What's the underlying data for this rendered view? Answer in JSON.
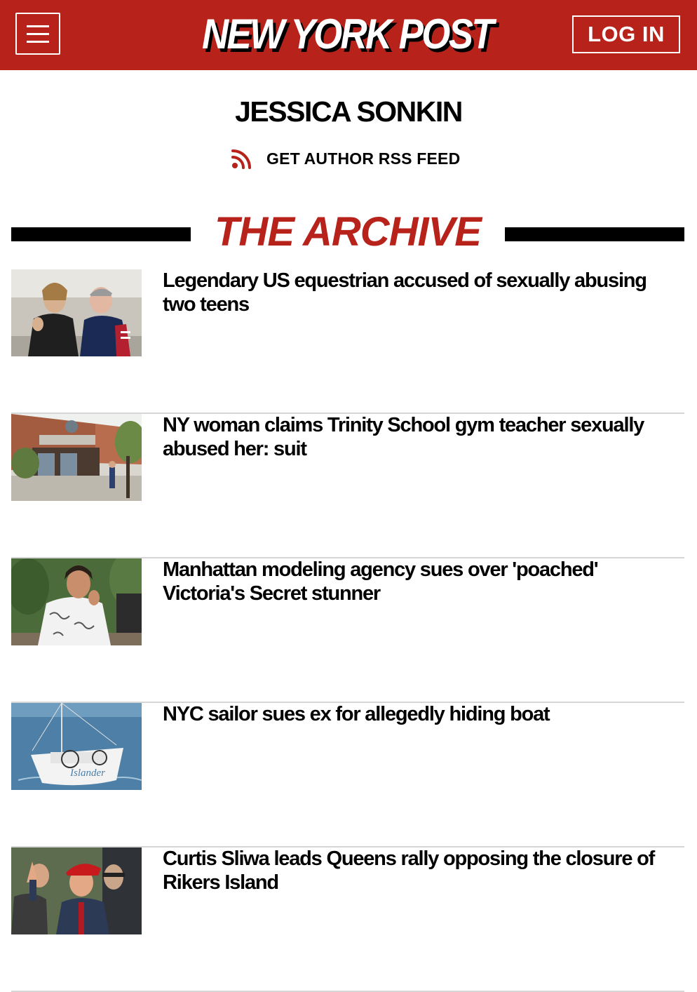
{
  "header": {
    "logo_text": "NEW YORK POST",
    "login_label": "LOG IN",
    "menu_icon": "hamburger-menu-icon",
    "brand_color": "#b7221b"
  },
  "author": {
    "name": "JESSICA SONKIN",
    "rss_label": "GET AUTHOR RSS FEED",
    "rss_icon": "rss-icon"
  },
  "archive": {
    "title": "THE ARCHIVE",
    "title_color": "#b7221b"
  },
  "articles": [
    {
      "headline": "Legendary US equestrian accused of sexually abusing two teens",
      "image": "two people talking outdoors"
    },
    {
      "headline": "NY woman claims Trinity School gym teacher sexually abused her: suit",
      "image": "school building entrance"
    },
    {
      "headline": "Manhattan modeling agency sues over 'poached' Victoria's Secret stunner",
      "image": "woman in patterned jacket"
    },
    {
      "headline": "NYC sailor sues ex for allegedly hiding boat",
      "image": "sailboat on water"
    },
    {
      "headline": "Curtis Sliwa leads Queens rally opposing the closure of Rikers Island",
      "image": "man in red beret at rally"
    }
  ]
}
